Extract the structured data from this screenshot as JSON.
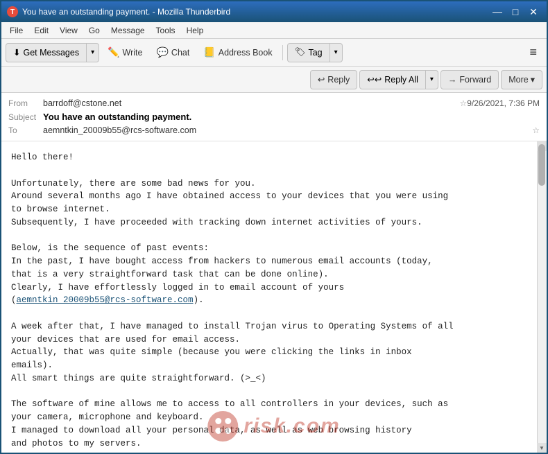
{
  "titleBar": {
    "title": "You have an outstanding payment. - Mozilla Thunderbird",
    "minimize": "—",
    "maximize": "□",
    "close": "✕"
  },
  "menuBar": {
    "items": [
      "File",
      "Edit",
      "View",
      "Go",
      "Message",
      "Tools",
      "Help"
    ]
  },
  "toolbar": {
    "getMessages": "Get Messages",
    "write": "Write",
    "chat": "Chat",
    "addressBook": "Address Book",
    "tag": "Tag"
  },
  "actionBar": {
    "reply": "Reply",
    "replyAll": "Reply All",
    "forward": "Forward",
    "more": "More"
  },
  "emailHeader": {
    "fromLabel": "From",
    "fromValue": "barrdoff@cstone.net",
    "subjectLabel": "Subject",
    "subjectValue": "You have an outstanding payment.",
    "dateValue": "9/26/2021, 7:36 PM",
    "toLabel": "To",
    "toValue": "aemntkin_20009b55@rcs-software.com"
  },
  "emailBody": {
    "line1": "Hello there!",
    "line2": "",
    "line3": "Unfortunately, there are some bad news for you.",
    "line4": "Around several months ago I have obtained access to your devices that you were using",
    "line5": "to browse internet.",
    "line6": "Subsequently, I have proceeded with tracking down internet activities of yours.",
    "line7": "",
    "line8": "Below, is the sequence of past events:",
    "line9": "In the past, I have bought access from hackers to numerous email accounts (today,",
    "line10": "that is a very straightforward task that can be done online).",
    "line11": "Clearly, I have effortlessly logged in to email account of yours",
    "line12": "(aemntkin_20009b55@rcs-software.com).",
    "line13": "",
    "line14": "A week after that, I have managed to install Trojan virus to Operating Systems of all",
    "line15": "your devices that are used for email access.",
    "line16": "Actually, that was quite simple (because you were clicking the links in inbox",
    "line17": "emails).",
    "line18": "All smart things are quite straightforward. (>_<)",
    "line19": "",
    "line20": "The software of mine allows me to access to all controllers in your devices, such as",
    "line21": "your camera, microphone and keyboard.",
    "line22": "I managed to download all your personal data, as well as web browsing history",
    "line23": "and photos to my servers.",
    "emailLink": "aemntkin_20009b55@rcs-software.com"
  },
  "watermark": {
    "text": "risk.com"
  }
}
